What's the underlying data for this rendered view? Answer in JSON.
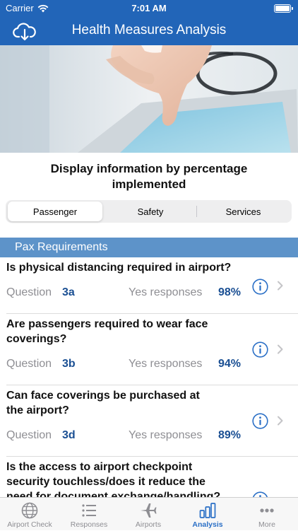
{
  "status_bar": {
    "carrier": "Carrier",
    "time": "7:01 AM"
  },
  "nav": {
    "title": "Health Measures Analysis",
    "left_icon": "cloud-download-icon"
  },
  "prompt": "Display information by percentage implemented",
  "segments": [
    {
      "label": "Passenger",
      "selected": true
    },
    {
      "label": "Safety",
      "selected": false
    },
    {
      "label": "Services",
      "selected": false
    }
  ],
  "section": {
    "title": "Pax Requirements"
  },
  "rows": [
    {
      "question": "Is physical distancing required in airport?",
      "question_label": "Question",
      "code": "3a",
      "yes_label": "Yes responses",
      "percent": "98%"
    },
    {
      "question": "Are passengers required to wear face coverings?",
      "question_label": "Question",
      "code": "3b",
      "yes_label": "Yes responses",
      "percent": "94%"
    },
    {
      "question": "Can face coverings be purchased at the airport?",
      "question_label": "Question",
      "code": "3d",
      "yes_label": "Yes responses",
      "percent": "89%"
    },
    {
      "question": "Is the access to airport checkpoint security touchless/does it reduce the need for document exchange/handling?"
    }
  ],
  "tabs": [
    {
      "label": "Airport Check",
      "icon": "globe-icon",
      "active": false
    },
    {
      "label": "Responses",
      "icon": "list-icon",
      "active": false
    },
    {
      "label": "Airports",
      "icon": "airplane-icon",
      "active": false
    },
    {
      "label": "Analysis",
      "icon": "bar-chart-icon",
      "active": true
    },
    {
      "label": "More",
      "icon": "more-dots-icon",
      "active": false
    }
  ],
  "colors": {
    "nav": "#2265b8",
    "section": "#5d93c9",
    "accent": "#2a6fc6",
    "value": "#1a4f93"
  }
}
